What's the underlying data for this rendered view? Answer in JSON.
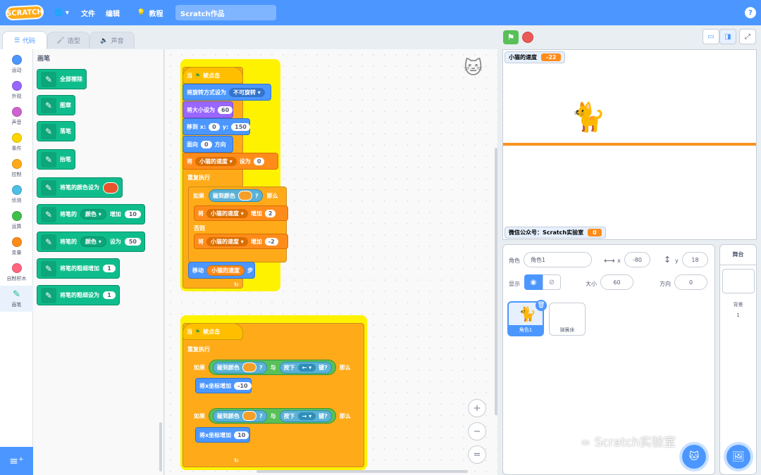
{
  "menubar": {
    "logo": "SCRATCH",
    "file": "文件",
    "edit": "编辑",
    "tutorials": "教程",
    "project_title": "Scratch作品",
    "help": "?"
  },
  "tabs": {
    "code": "代码",
    "costumes": "造型",
    "sounds": "声音"
  },
  "categories": [
    {
      "label": "运动",
      "color": "#4c97ff"
    },
    {
      "label": "外观",
      "color": "#9966ff"
    },
    {
      "label": "声音",
      "color": "#cf63cf"
    },
    {
      "label": "事件",
      "color": "#ffd500"
    },
    {
      "label": "控制",
      "color": "#ffab19"
    },
    {
      "label": "侦测",
      "color": "#4cbfe6"
    },
    {
      "label": "运算",
      "color": "#40bf4a"
    },
    {
      "label": "变量",
      "color": "#ff8c1a"
    },
    {
      "label": "自制积木",
      "color": "#ff6680"
    },
    {
      "label": "画笔",
      "color": "#0fbd8c"
    }
  ],
  "palette": {
    "title": "画笔",
    "blocks": {
      "clear": "全部擦除",
      "stamp": "图章",
      "pen_down": "落笔",
      "pen_up": "抬笔",
      "set_color_to": "将笔的颜色设为",
      "change_pre": "将笔的",
      "change_dd": "颜色",
      "change_mid": "增加",
      "change_val": "10",
      "set_pre": "将笔的",
      "set_dd": "颜色",
      "set_mid": "设为",
      "set_val": "50",
      "size_change": "将笔的粗细增加",
      "size_change_val": "1",
      "size_set": "将笔的粗细设为",
      "size_set_val": "1"
    }
  },
  "script1": {
    "when_flag": "当",
    "clicked": "被点击",
    "rotation_style": "将旋转方式设为",
    "rotation_value": "不可旋转",
    "set_size": "将大小设为",
    "size_val": "60",
    "goto": "移到 x:",
    "goto_x": "0",
    "goto_y_label": "y:",
    "goto_y": "150",
    "point": "面向",
    "point_val": "0",
    "direction": "方向",
    "set": "将",
    "var_name": "小猫的速度",
    "to": "设为",
    "set_val": "0",
    "forever": "重复执行",
    "if": "如果",
    "touching_color": "碰到颜色",
    "q": "?",
    "then": "那么",
    "change_set": "将",
    "change_var": "小猫的速度",
    "change_by": "增加",
    "change_val1": "2",
    "else": "否则",
    "change_val2": "-2",
    "move": "移动",
    "move_reporter": "小猫的速度",
    "steps": "步",
    "loop_arrow": "↻"
  },
  "script2": {
    "when_flag": "当",
    "clicked": "被点击",
    "forever": "重复执行",
    "if": "如果",
    "touching_color": "碰到颜色",
    "q": "?",
    "and": "与",
    "key_pressed": "按下",
    "key_left": "←",
    "key_right": "→",
    "key_q": "键?",
    "then": "那么",
    "change_x": "将x坐标增加",
    "val1": "-10",
    "val2": "10",
    "loop_arrow": "↻"
  },
  "zoom": {
    "in": "+",
    "out": "−",
    "reset": "="
  },
  "stage": {
    "monitor1_label": "小猫的速度",
    "monitor1_value": "-22",
    "monitor2_label": "微信公众号：Scratch实验室",
    "monitor2_value": "0",
    "line_color": "#f7931e"
  },
  "sprite_info": {
    "sprite_label": "角色",
    "sprite_name": "角色1",
    "x_label": "x",
    "x_val": "-80",
    "y_label": "y",
    "y_val": "18",
    "show_label": "显示",
    "size_label": "大小",
    "size_val": "60",
    "dir_label": "方向",
    "dir_val": "0"
  },
  "sprites": [
    "角色1",
    "弹簧床"
  ],
  "stage_pane": {
    "title": "舞台",
    "backdrops_label": "背景",
    "backdrops_count": "1"
  },
  "watermark": "Scratch实验室"
}
